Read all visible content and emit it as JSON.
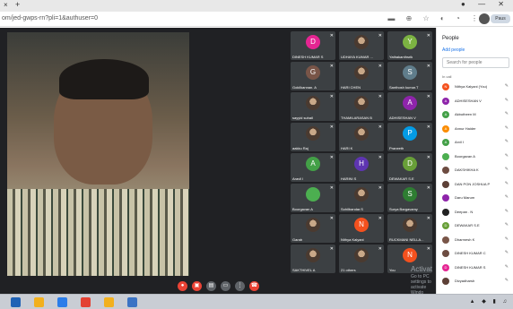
{
  "browser": {
    "tab_close": "×",
    "tab_add": "+",
    "window_buttons": "● — ✕",
    "url": "om/jed-gwps-rn?pli=1&authuser=0",
    "addr_icons": "▬ ⊕ ☆ ◐ ◔ ⋮",
    "profile_label": "Paus"
  },
  "tiles": [
    {
      "initial": "D",
      "color": "#e52592",
      "name": "DINESH KUMAR S",
      "type": "letter"
    },
    {
      "initial": "",
      "color": "",
      "name": "UDHAYA KUMAR ...",
      "type": "photo"
    },
    {
      "initial": "Y",
      "color": "#7cb342",
      "name": "Yathakanthsrik",
      "type": "letter"
    },
    {
      "initial": "G",
      "color": "#795548",
      "name": "Gokilkannan. A",
      "type": "letter"
    },
    {
      "initial": "",
      "color": "",
      "name": "HARI CHEN",
      "type": "photo"
    },
    {
      "initial": "S",
      "color": "#607d8b",
      "name": "Santhosh kumar.T",
      "type": "letter"
    },
    {
      "initial": "",
      "color": "",
      "name": "sayyid suhail",
      "type": "photo"
    },
    {
      "initial": "",
      "color": "",
      "name": "THAMILARASAN B",
      "type": "photo"
    },
    {
      "initial": "A",
      "color": "#8e24aa",
      "name": "ADHISESHAN V",
      "type": "letter"
    },
    {
      "initial": "",
      "color": "",
      "name": "aakku Raj",
      "type": "photo"
    },
    {
      "initial": "",
      "color": "",
      "name": "HARI K",
      "type": "photo"
    },
    {
      "initial": "P",
      "color": "#039be5",
      "name": "Praneeth",
      "type": "letter"
    },
    {
      "initial": "A",
      "color": "#43a047",
      "name": "Aravil I",
      "type": "letter"
    },
    {
      "initial": "H",
      "color": "#5e35b1",
      "name": "HARINI S",
      "type": "letter"
    },
    {
      "initial": "D",
      "color": "#689f38",
      "name": "DEWAKAR S.E",
      "type": "letter"
    },
    {
      "initial": "",
      "color": "#4caf50",
      "name": "Boorgavan A",
      "type": "letter"
    },
    {
      "initial": "",
      "color": "",
      "name": "Sohilbandar.S",
      "type": "photo"
    },
    {
      "initial": "S",
      "color": "#2e7d32",
      "name": "Surya Bargavamy",
      "type": "letter"
    },
    {
      "initial": "",
      "color": "",
      "name": "Garab",
      "type": "photo"
    },
    {
      "initial": "N",
      "color": "#f4511e",
      "name": "Nithya Kalyani",
      "type": "letter"
    },
    {
      "initial": "",
      "color": "",
      "name": "RUCKMANI NELLA...",
      "type": "photo"
    },
    {
      "initial": "",
      "color": "",
      "name": "SAKTHIVEL A",
      "type": "photo"
    },
    {
      "initial": "",
      "color": "",
      "name": "21 others",
      "type": "photo"
    },
    {
      "initial": "N",
      "color": "#f4511e",
      "name": "You",
      "type": "letter"
    }
  ],
  "controls": [
    {
      "glyph": "●",
      "color": "#ea4335"
    },
    {
      "glyph": "▣",
      "color": "#ea4335"
    },
    {
      "glyph": "▤",
      "color": "#5f6368"
    },
    {
      "glyph": "▭",
      "color": "#5f6368"
    },
    {
      "glyph": "⋮",
      "color": "#5f6368"
    },
    {
      "glyph": "☎",
      "color": "#ea4335"
    }
  ],
  "activate": {
    "line1": "Activat",
    "line2": "Go to PC settings to activate Windo"
  },
  "people": {
    "title": "People",
    "add": "Add people",
    "search_placeholder": "Search for people",
    "section": "In call",
    "items": [
      {
        "initial": "N",
        "color": "#f4511e",
        "name": "Nithya Kalyani (You)"
      },
      {
        "initial": "A",
        "color": "#8e24aa",
        "name": "ADHISESHAN V"
      },
      {
        "initial": "A",
        "color": "#43a047",
        "name": "Akbutheen M"
      },
      {
        "initial": "A",
        "color": "#fb8c00",
        "name": "Annur Haider"
      },
      {
        "initial": "A",
        "color": "#43a047",
        "name": "Arvil I"
      },
      {
        "initial": "",
        "color": "#4caf50",
        "name": "Boorgavan A"
      },
      {
        "initial": "",
        "color": "#6d4c41",
        "name": "DAKSHIKHA K"
      },
      {
        "initial": "",
        "color": "#5d4037",
        "name": "DAN PON JOSHUA P"
      },
      {
        "initial": "",
        "color": "#8e24aa",
        "name": "Daru Marum"
      },
      {
        "initial": "",
        "color": "#212121",
        "name": "Deepan . N"
      },
      {
        "initial": "D",
        "color": "#689f38",
        "name": "DEWAKAR S.E"
      },
      {
        "initial": "",
        "color": "#795548",
        "name": "Dharmesh K"
      },
      {
        "initial": "",
        "color": "#6d4c41",
        "name": "DINESH KUMAR C"
      },
      {
        "initial": "D",
        "color": "#e52592",
        "name": "DINESH KUMAR S"
      },
      {
        "initial": "",
        "color": "#5d4037",
        "name": "Divyadharsh"
      }
    ]
  },
  "taskbar": {
    "icons": [
      "#1f62b5",
      "#f2b01e",
      "#2b7de9",
      "#e34133",
      "#f2b01e",
      "#3b73c4"
    ],
    "tray": "▲ ◆ ▮ ♫"
  }
}
